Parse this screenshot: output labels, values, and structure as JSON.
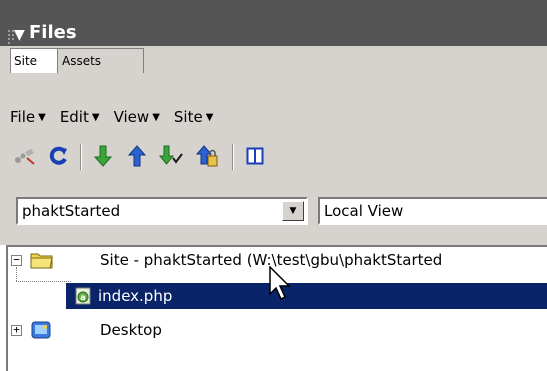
{
  "panel": {
    "title": "Files",
    "collapse_arrow": "▼"
  },
  "tabs": [
    {
      "label": "Site",
      "active": true
    },
    {
      "label": "Assets",
      "active": false
    }
  ],
  "menu": [
    {
      "label": "File"
    },
    {
      "label": "Edit"
    },
    {
      "label": "View"
    },
    {
      "label": "Site"
    }
  ],
  "toolbar": {
    "icons": [
      "connect-icon",
      "refresh-icon",
      "get-files-icon",
      "put-files-icon",
      "check-out-icon",
      "check-in-icon",
      "expand-panel-icon"
    ]
  },
  "site_select": {
    "value": "phaktStarted"
  },
  "view_select": {
    "value": "Local View"
  },
  "tree": {
    "root": {
      "label": "Site - phaktStarted (W:\\test\\gbu\\phaktStarted",
      "expander": "−"
    },
    "file": {
      "label": "index.php",
      "selected": true
    },
    "desktop": {
      "label": "Desktop",
      "expander": "+"
    }
  },
  "colors": {
    "title_bar": "#555555",
    "panel_bg": "#d6d3ce",
    "selection": "#0a246a"
  }
}
